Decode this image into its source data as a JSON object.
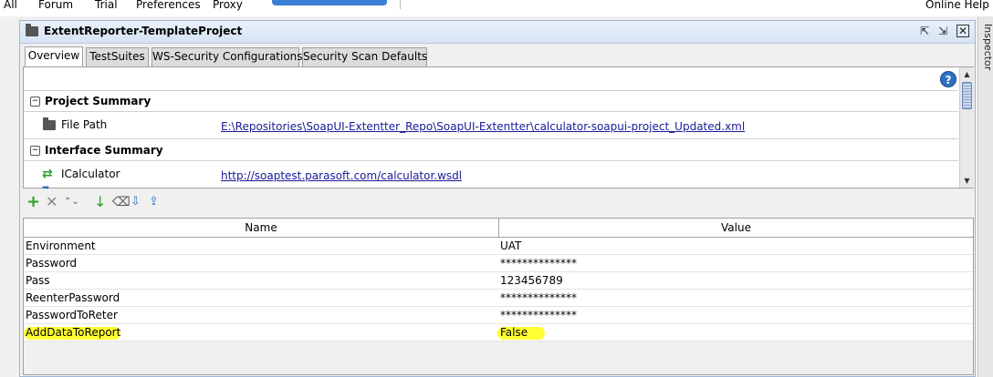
{
  "top_menu": {
    "items": [
      "All",
      "Forum",
      "Trial",
      "Preferences",
      "Proxy"
    ],
    "online_help": "Online Help"
  },
  "right_panel": {
    "label": "Inspector"
  },
  "window": {
    "title": "ExtentReporter-TemplateProject",
    "tabs": [
      "Overview",
      "TestSuites",
      "WS-Security Configurations",
      "Security Scan Defaults"
    ],
    "active_tab": "Overview"
  },
  "summary": {
    "help_label": "?",
    "project_summary_title": "Project Summary",
    "file_path_label": "File Path",
    "file_path_value": "E:\\Repositories\\SoapUI-Extentter_Repo\\SoapUI-Extentter\\calculator-soapui-project_Updated.xml",
    "interface_summary_title": "Interface Summary",
    "interface_name": "ICalculator",
    "interface_url": "http://soaptest.parasoft.com/calculator.wsdl"
  },
  "toolbar": {
    "icons": [
      "add-icon",
      "remove-icon",
      "move-up-down-icon",
      "move-down-icon",
      "clear-icon",
      "import-icon",
      "export-icon"
    ]
  },
  "properties_table": {
    "headers": {
      "name": "Name",
      "value": "Value"
    },
    "rows": [
      {
        "name": "Environment",
        "value": "UAT"
      },
      {
        "name": "Password",
        "value": "**************"
      },
      {
        "name": "Pass",
        "value": "123456789"
      },
      {
        "name": "ReenterPassword",
        "value": "**************"
      },
      {
        "name": "PasswordToReter",
        "value": "**************"
      },
      {
        "name": "AddDataToReport",
        "value": "False"
      }
    ],
    "highlight_color": "#ffff33"
  },
  "colors": {
    "accent_blue": "#3b80d6",
    "link": "#1a1a9a",
    "add_green": "#2aa02a"
  }
}
